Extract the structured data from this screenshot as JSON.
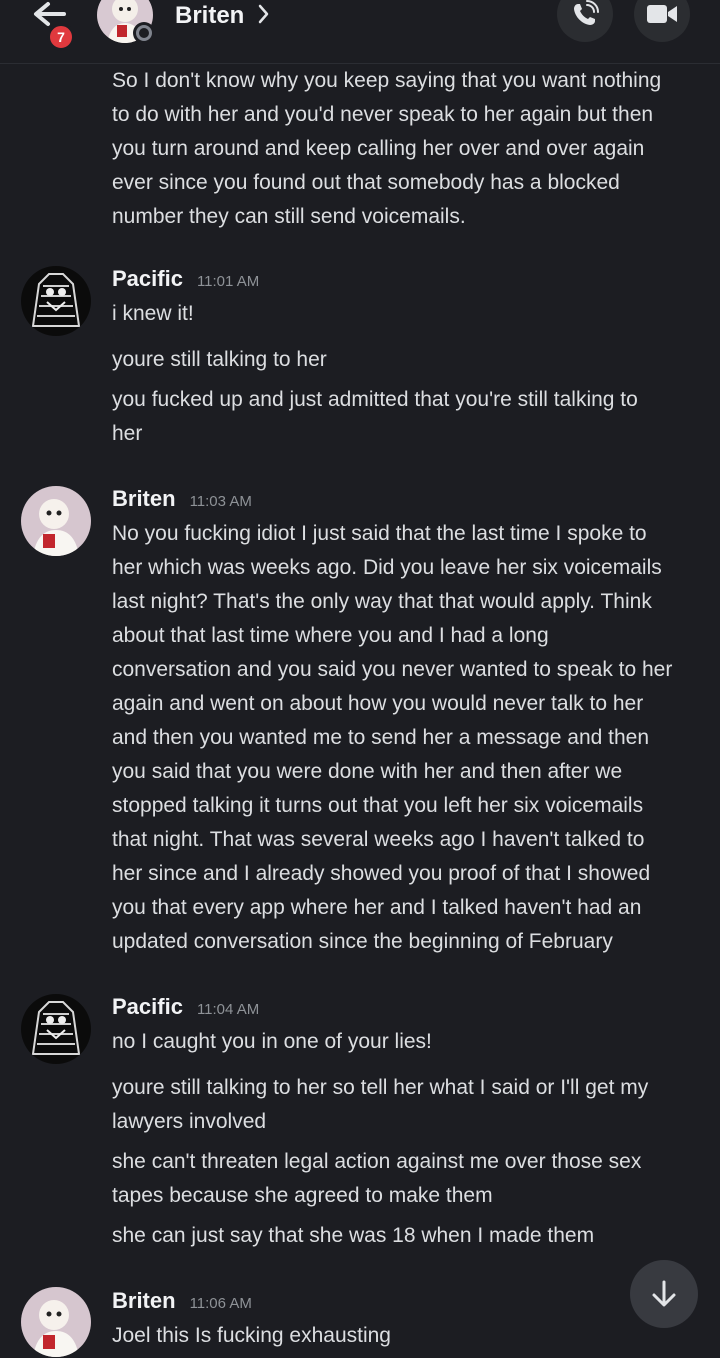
{
  "header": {
    "unread_count": "7",
    "title": "Briten",
    "back_icon": "arrow-left-icon",
    "call_icon": "phone-call-icon",
    "video_icon": "video-camera-icon"
  },
  "messages": {
    "m0": {
      "lines": [
        "So I don't know why you keep saying that you want nothing",
        "to do with her and you'd never speak to her again but then",
        "you turn around and keep calling her over and over again",
        "ever since you found out that somebody has a blocked",
        "number they can still send voicemails."
      ]
    },
    "g1": {
      "author": "Pacific",
      "time": "11:01 AM",
      "m1": "i knew it!",
      "m2": "youre still talking to her",
      "m3a": "you fucked up and just admitted that you're still talking to",
      "m3b": "her"
    },
    "g2": {
      "author": "Briten",
      "time": "11:03 AM",
      "lines": [
        "No you fucking idiot I just said that the last time I spoke to",
        "her which was weeks ago. Did you leave her six voicemails",
        "last night? That's the only way that that would apply. Think",
        "about that last time where you and I had a long",
        "conversation and you said you never wanted to speak to her",
        "again and went on about how you would never talk to her",
        "and then you wanted me to send her a message and then",
        "you said that you were done with her and then after we",
        "stopped talking it turns out that you left her six voicemails",
        "that night. That was several weeks ago I haven't talked to",
        "her since and I already showed you proof of that I showed",
        "you that every app where her and I talked haven't had an",
        "updated conversation since the beginning of February"
      ]
    },
    "g3": {
      "author": "Pacific",
      "time": "11:04 AM",
      "m1": "no I caught you in one of your lies!",
      "m2a": "youre still talking to her so tell her what I said or I'll get my",
      "m2b": "lawyers involved",
      "m3a": "she can't threaten legal action against me over those sex",
      "m3b": "tapes because she agreed to make them",
      "m4": "she can just say that she was 18 when I made them"
    },
    "g4": {
      "author": "Briten",
      "time": "11:06 AM",
      "m1": "Joel this Is fucking exhausting"
    }
  },
  "scroll_icon": "arrow-down-icon",
  "colors": {
    "background": "#1c1d22",
    "text": "#dcdee1",
    "timestamp": "#8e9297",
    "badge": "#e0393e"
  }
}
